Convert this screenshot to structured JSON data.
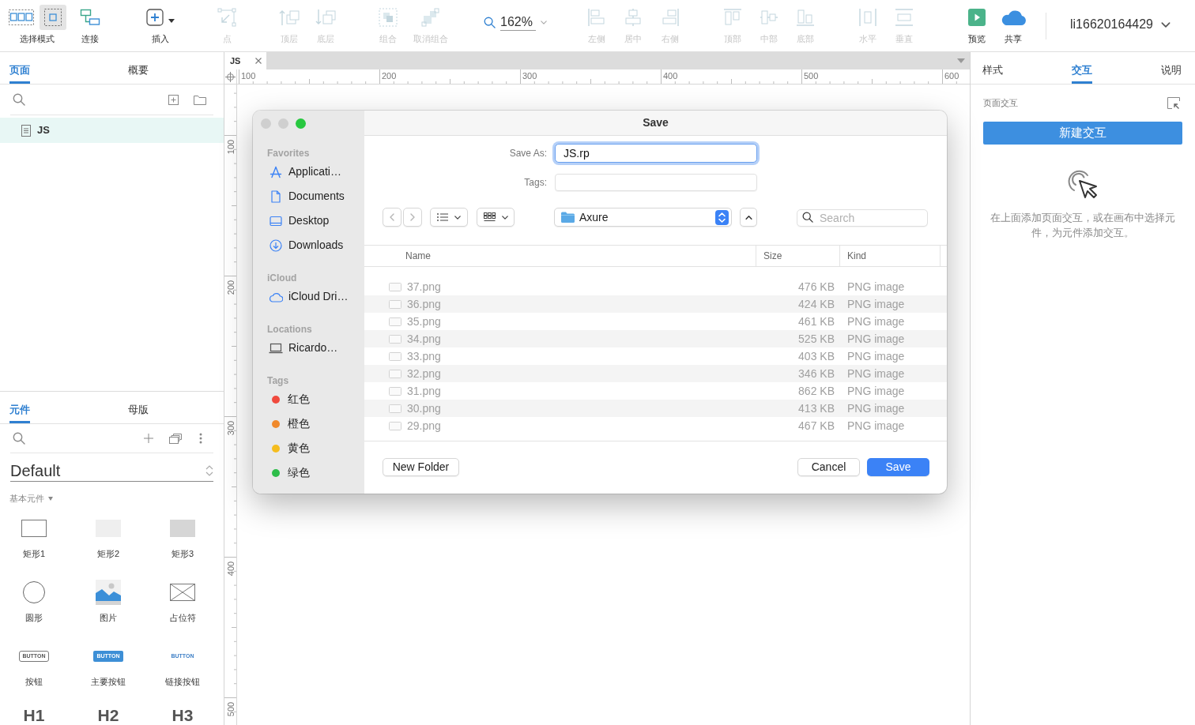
{
  "toolbar": {
    "items": [
      {
        "kind": "mode",
        "label": "选择模式",
        "options": [
          {
            "selected": false
          },
          {
            "selected": true
          }
        ]
      },
      {
        "kind": "tool",
        "label": "连接",
        "disabled": false
      },
      {
        "kind": "tool",
        "label": "插入",
        "disabled": false,
        "dropdown": true
      },
      {
        "kind": "tool",
        "label": "点",
        "disabled": true
      },
      {
        "kind": "tool",
        "label": "顶层",
        "disabled": true
      },
      {
        "kind": "tool",
        "label": "底层",
        "disabled": true
      },
      {
        "kind": "tool",
        "label": "组合",
        "disabled": true
      },
      {
        "kind": "tool",
        "label": "取消组合",
        "disabled": true
      },
      {
        "kind": "zoom",
        "value": "162%"
      },
      {
        "kind": "tool",
        "label": "左侧",
        "disabled": true
      },
      {
        "kind": "tool",
        "label": "居中",
        "disabled": true
      },
      {
        "kind": "tool",
        "label": "右侧",
        "disabled": true
      },
      {
        "kind": "tool",
        "label": "顶部",
        "disabled": true
      },
      {
        "kind": "tool",
        "label": "中部",
        "disabled": true
      },
      {
        "kind": "tool",
        "label": "底部",
        "disabled": true
      },
      {
        "kind": "tool",
        "label": "水平",
        "disabled": true
      },
      {
        "kind": "tool",
        "label": "垂直",
        "disabled": true
      },
      {
        "kind": "tool",
        "label": "预览",
        "disabled": false
      },
      {
        "kind": "tool",
        "label": "共享",
        "disabled": false
      }
    ],
    "user": "li16620164429"
  },
  "pages_panel": {
    "tabs": [
      {
        "label": "页面",
        "selected": true
      },
      {
        "label": "概要",
        "selected": false
      }
    ],
    "pages": [
      {
        "name": "JS",
        "selected": true
      }
    ]
  },
  "widgets_panel": {
    "tabs": [
      {
        "label": "元件",
        "selected": true
      },
      {
        "label": "母版",
        "selected": false
      }
    ],
    "library": "Default",
    "category": "基本元件",
    "widgets": [
      {
        "kind": "rect-outline",
        "label": "矩形1"
      },
      {
        "kind": "rect-light",
        "label": "矩形2"
      },
      {
        "kind": "rect-gray",
        "label": "矩形3"
      },
      {
        "kind": "circle",
        "label": "圆形"
      },
      {
        "kind": "image",
        "label": "图片"
      },
      {
        "kind": "placeholder",
        "label": "占位符"
      },
      {
        "kind": "button",
        "label": "按钮",
        "text": "BUTTON"
      },
      {
        "kind": "primary-button",
        "label": "主要按钮",
        "text": "BUTTON"
      },
      {
        "kind": "link-button",
        "label": "链接按钮",
        "text": "BUTTON"
      },
      {
        "kind": "heading",
        "text": "H1"
      },
      {
        "kind": "heading",
        "text": "H2"
      },
      {
        "kind": "heading",
        "text": "H3"
      }
    ]
  },
  "document_tabs": [
    {
      "label": "JS",
      "selected": true
    }
  ],
  "rulers": {
    "horizontal": [
      "100",
      "200",
      "300",
      "400",
      "500",
      "600"
    ],
    "vertical": [
      "100",
      "200",
      "300",
      "400",
      "500"
    ]
  },
  "inspector": {
    "tabs": [
      {
        "label": "样式",
        "selected": false
      },
      {
        "label": "交互",
        "selected": true
      },
      {
        "label": "说明",
        "selected": false
      }
    ],
    "section": "页面交互",
    "new_button": "新建交互",
    "hint": "在上面添加页面交互，或在画布中选择元件，为元件添加交互。"
  },
  "save_dialog": {
    "window_controls": [
      {
        "disabled": true
      },
      {
        "disabled": true
      },
      {
        "disabled": false
      }
    ],
    "title": "Save",
    "sidebar": [
      {
        "kind": "places",
        "heading": "Favorites",
        "items": [
          {
            "label": "Applicati…"
          },
          {
            "label": "Documents"
          },
          {
            "label": "Desktop"
          },
          {
            "label": "Downloads"
          }
        ]
      },
      {
        "kind": "places",
        "heading": "iCloud",
        "items": [
          {
            "label": "iCloud Dri…"
          }
        ]
      },
      {
        "kind": "places",
        "heading": "Locations",
        "items": [
          {
            "label": "Ricardo…"
          }
        ]
      },
      {
        "kind": "tags",
        "heading": "Tags",
        "items": [
          {
            "label": "红色",
            "color": "#f04a3e"
          },
          {
            "label": "橙色",
            "color": "#f0892b"
          },
          {
            "label": "黄色",
            "color": "#f5bd1f"
          },
          {
            "label": "绿色",
            "color": "#2ebd4a"
          }
        ]
      }
    ],
    "save_as": {
      "label": "Save As:",
      "value": "JS.rp"
    },
    "tags": {
      "label": "Tags:"
    },
    "location": "Axure",
    "search": {
      "placeholder": "Search"
    },
    "columns": [
      "Name",
      "Size",
      "Kind"
    ],
    "rows": [
      {
        "cells": [
          "37.png",
          "476 KB",
          "PNG image"
        ]
      },
      {
        "cells": [
          "36.png",
          "424 KB",
          "PNG image"
        ]
      },
      {
        "cells": [
          "35.png",
          "461 KB",
          "PNG image"
        ]
      },
      {
        "cells": [
          "34.png",
          "525 KB",
          "PNG image"
        ]
      },
      {
        "cells": [
          "33.png",
          "403 KB",
          "PNG image"
        ]
      },
      {
        "cells": [
          "32.png",
          "346 KB",
          "PNG image"
        ]
      },
      {
        "cells": [
          "31.png",
          "862 KB",
          "PNG image"
        ]
      },
      {
        "cells": [
          "30.png",
          "413 KB",
          "PNG image"
        ]
      },
      {
        "cells": [
          "29.png",
          "467 KB",
          "PNG image"
        ]
      }
    ],
    "new_folder": "New Folder",
    "buttons": [
      {
        "kind": "secondary",
        "label": "Cancel"
      },
      {
        "kind": "primary",
        "label": "Save"
      }
    ]
  }
}
